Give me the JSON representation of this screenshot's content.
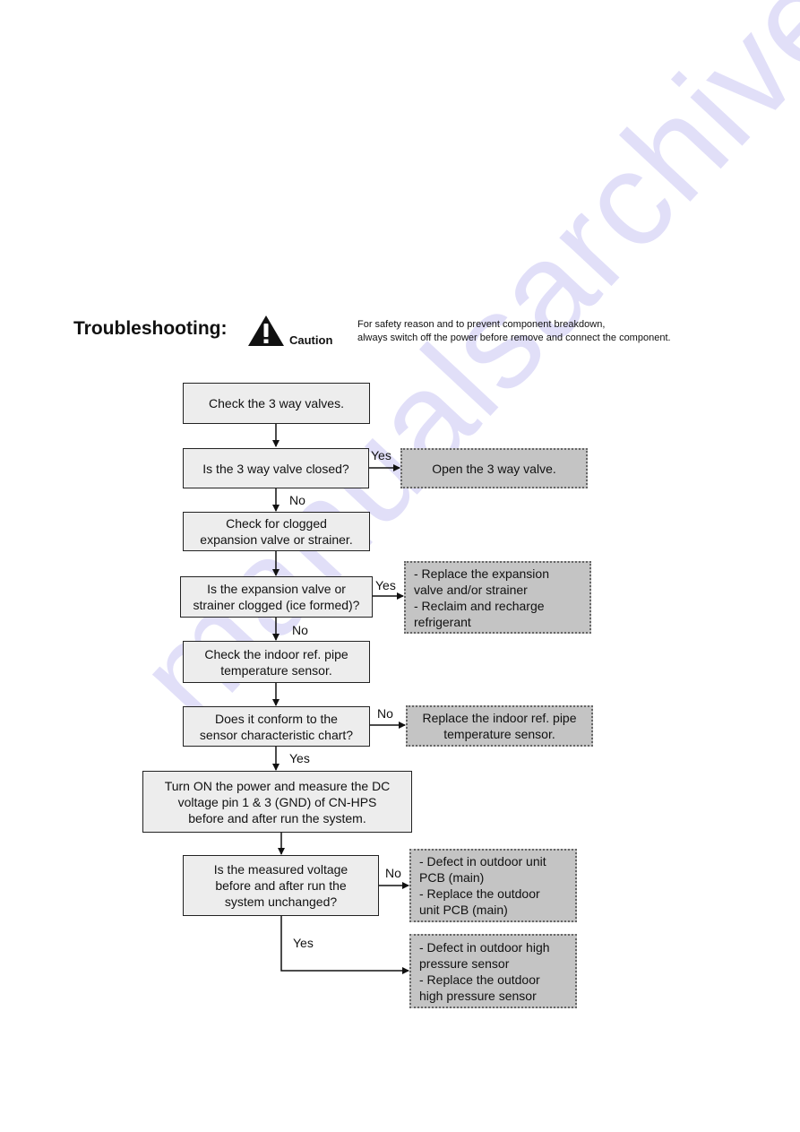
{
  "watermark": "manualsarchive.com",
  "header": {
    "title": "Troubleshooting:",
    "caution_icon": "warning-triangle-icon",
    "caution_label": "Caution",
    "caution_lines": [
      "For safety reason and to prevent component breakdown,",
      "always switch off the power before remove and connect the component."
    ]
  },
  "flowchart": {
    "steps": [
      {
        "id": "s1",
        "lines": [
          "Check the 3 way valves."
        ]
      },
      {
        "id": "s2",
        "lines": [
          "Is the 3 way valve closed?"
        ]
      },
      {
        "id": "s3",
        "lines": [
          "Check for clogged",
          "expansion valve or strainer."
        ]
      },
      {
        "id": "s4",
        "lines": [
          "Is the expansion valve or",
          "strainer clogged (ice formed)?"
        ]
      },
      {
        "id": "s5",
        "lines": [
          "Check the indoor ref. pipe",
          "temperature sensor."
        ]
      },
      {
        "id": "s6",
        "lines": [
          "Does it conform to the",
          "sensor characteristic chart?"
        ]
      },
      {
        "id": "s7",
        "lines": [
          "Turn ON the power  and measure the DC",
          "voltage pin 1 & 3 (GND) of CN-HPS",
          "before and after  run the system."
        ]
      },
      {
        "id": "s8",
        "lines": [
          "Is the measured voltage",
          "before and after run the",
          "system unchanged?"
        ]
      }
    ],
    "outcomes": [
      {
        "id": "o1",
        "lines": [
          "Open the 3 way valve."
        ]
      },
      {
        "id": "o2",
        "lines": [
          "- Replace the expansion",
          "valve and/or strainer",
          "- Reclaim and recharge",
          "refrigerant"
        ]
      },
      {
        "id": "o3",
        "lines": [
          "Replace the indoor ref. pipe",
          "temperature sensor."
        ]
      },
      {
        "id": "o4",
        "lines": [
          "- Defect in outdoor unit",
          "PCB (main)",
          "- Replace the outdoor",
          "unit PCB (main)"
        ]
      },
      {
        "id": "o5",
        "lines": [
          "- Defect in outdoor high",
          "pressure sensor",
          "- Replace the outdoor",
          "high pressure sensor"
        ]
      }
    ],
    "edge_labels": {
      "s2_yes": "Yes",
      "s2_no": "No",
      "s4_yes": "Yes",
      "s4_no": "No",
      "s6_no": "No",
      "s6_yes": "Yes",
      "s8_no": "No",
      "s8_yes": "Yes"
    }
  }
}
